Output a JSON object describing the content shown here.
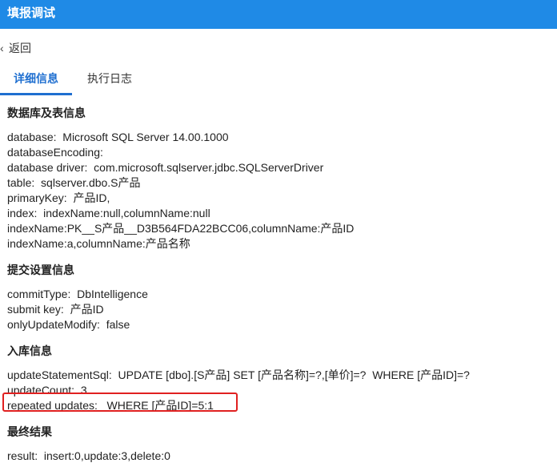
{
  "titlebar": {
    "title": "填报调试"
  },
  "nav": {
    "back_label": "返回"
  },
  "tabs": [
    {
      "label": "详细信息",
      "active": true
    },
    {
      "label": "执行日志",
      "active": false
    }
  ],
  "sections": {
    "db": {
      "title": "数据库及表信息",
      "lines": [
        "database:  Microsoft SQL Server 14.00.1000",
        "databaseEncoding:",
        "database driver:  com.microsoft.sqlserver.jdbc.SQLServerDriver",
        "table:  sqlserver.dbo.S产品",
        "primaryKey:  产品ID,",
        "index:  indexName:null,columnName:null",
        "indexName:PK__S产品__D3B564FDA22BCC06,columnName:产品ID",
        "indexName:a,columnName:产品名称"
      ]
    },
    "commit": {
      "title": "提交设置信息",
      "lines": [
        "commitType:  DbIntelligence",
        "submit key:  产品ID",
        "onlyUpdateModify:  false"
      ]
    },
    "storage": {
      "title": "入库信息",
      "lines": [
        "updateStatementSql:  UPDATE [dbo].[S产品] SET [产品名称]=?,[单价]=?  WHERE [产品ID]=?",
        "updateCount:  3",
        "repeated updates:   WHERE [产品ID]=5:1"
      ]
    },
    "result": {
      "title": "最终结果",
      "lines": [
        "result:  insert:0,update:3,delete:0"
      ]
    }
  },
  "colors": {
    "titlebar_bg": "#1f8ae6",
    "tab_active": "#1f6fd0",
    "highlight_border": "#e02020"
  }
}
